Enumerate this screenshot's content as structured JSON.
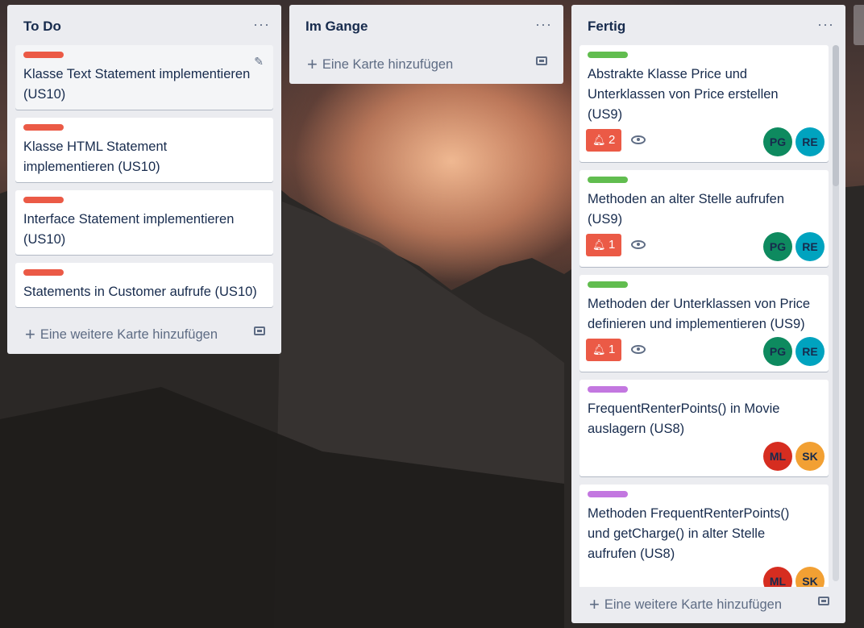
{
  "colors": {
    "red_label": "#eb5a46",
    "green_label": "#61bd4f",
    "purple_label": "#c377e0",
    "pg": "#0e8a5f",
    "re": "#00a3bf",
    "ml": "#d62d20",
    "sk": "#f2a033"
  },
  "lists": [
    {
      "title": "To Do",
      "menu": "···",
      "cards": [
        {
          "title": "Klasse Text Statement implementieren (US10)"
        },
        {
          "title": "Klasse HTML Statement implementieren (US10)"
        },
        {
          "title": "Interface Statement implementieren (US10)"
        },
        {
          "title": "Statements in Customer aufrufe (US10)"
        }
      ],
      "add": "Eine weitere Karte hinzufügen"
    },
    {
      "title": "Im Gange",
      "menu": "···",
      "add": "Eine Karte hinzufügen"
    },
    {
      "title": "Fertig",
      "menu": "···",
      "cards": [
        {
          "title": "Abstrakte Klasse Price und Unterklassen von Price erstellen (US9)",
          "notifications": "2",
          "avatars": [
            "PG",
            "RE"
          ]
        },
        {
          "title": "Methoden an alter Stelle aufrufen (US9)",
          "notifications": "1",
          "avatars": [
            "PG",
            "RE"
          ]
        },
        {
          "title": "Methoden der Unterklassen von Price definieren und implementieren (US9)",
          "notifications": "1",
          "avatars": [
            "PG",
            "RE"
          ]
        },
        {
          "title": "FrequentRenterPoints() in Movie auslagern (US8)",
          "avatars": [
            "ML",
            "SK"
          ]
        },
        {
          "title": "Methoden FrequentRenterPoints() und getCharge() in alter Stelle aufrufen (US8)",
          "avatars": [
            "ML",
            "SK"
          ]
        }
      ],
      "add": "Eine weitere Karte hinzufügen"
    }
  ]
}
